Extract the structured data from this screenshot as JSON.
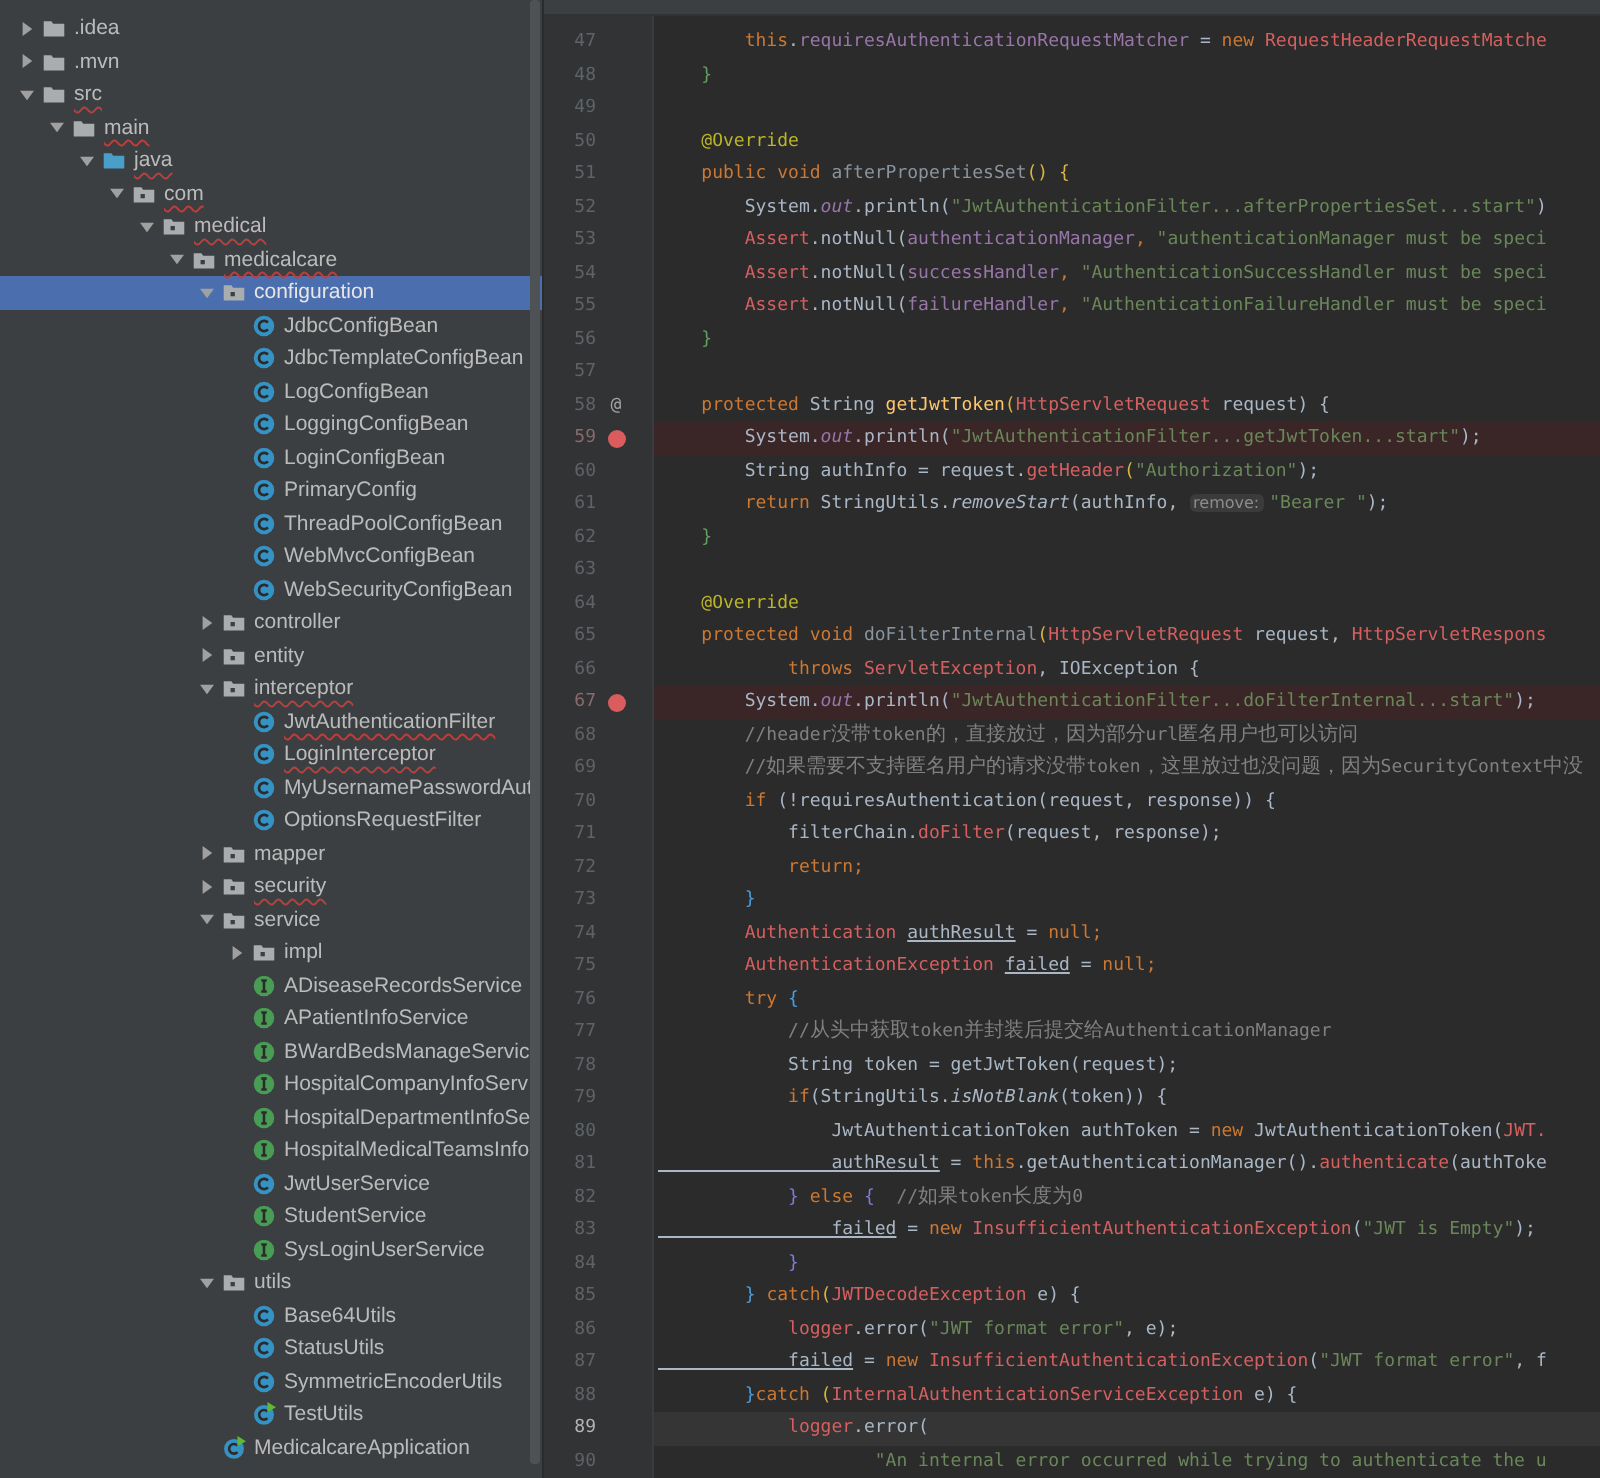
{
  "project_tree": {
    "nodes": [
      {
        "name": ".idea",
        "kind": "folder",
        "expanded": false,
        "selected": false,
        "spell_error": false
      },
      {
        "name": ".mvn",
        "kind": "folder",
        "expanded": false,
        "selected": false,
        "spell_error": false
      },
      {
        "name": "src",
        "kind": "folder",
        "expanded": true,
        "selected": false,
        "spell_error": true,
        "children": [
          {
            "name": "main",
            "kind": "folder",
            "expanded": true,
            "selected": false,
            "spell_error": true,
            "children": [
              {
                "name": "java",
                "kind": "source-folder",
                "expanded": true,
                "selected": false,
                "spell_error": true,
                "children": [
                  {
                    "name": "com",
                    "kind": "package",
                    "expanded": true,
                    "selected": false,
                    "spell_error": true,
                    "children": [
                      {
                        "name": "medical",
                        "kind": "package",
                        "expanded": true,
                        "selected": false,
                        "spell_error": true,
                        "children": [
                          {
                            "name": "medicalcare",
                            "kind": "package",
                            "expanded": true,
                            "selected": false,
                            "spell_error": true,
                            "children": [
                              {
                                "name": "configuration",
                                "kind": "package",
                                "expanded": true,
                                "selected": true,
                                "spell_error": false,
                                "children": [
                                  {
                                    "name": "JdbcConfigBean",
                                    "kind": "class",
                                    "selected": false,
                                    "spell_error": false
                                  },
                                  {
                                    "name": "JdbcTemplateConfigBean",
                                    "kind": "class",
                                    "selected": false,
                                    "spell_error": false
                                  },
                                  {
                                    "name": "LogConfigBean",
                                    "kind": "class",
                                    "selected": false,
                                    "spell_error": false
                                  },
                                  {
                                    "name": "LoggingConfigBean",
                                    "kind": "class",
                                    "selected": false,
                                    "spell_error": false
                                  },
                                  {
                                    "name": "LoginConfigBean",
                                    "kind": "class",
                                    "selected": false,
                                    "spell_error": false
                                  },
                                  {
                                    "name": "PrimaryConfig",
                                    "kind": "class",
                                    "selected": false,
                                    "spell_error": false
                                  },
                                  {
                                    "name": "ThreadPoolConfigBean",
                                    "kind": "class",
                                    "selected": false,
                                    "spell_error": false
                                  },
                                  {
                                    "name": "WebMvcConfigBean",
                                    "kind": "class",
                                    "selected": false,
                                    "spell_error": false
                                  },
                                  {
                                    "name": "WebSecurityConfigBean",
                                    "kind": "class",
                                    "selected": false,
                                    "spell_error": false
                                  }
                                ]
                              },
                              {
                                "name": "controller",
                                "kind": "package",
                                "expanded": false,
                                "selected": false,
                                "spell_error": false
                              },
                              {
                                "name": "entity",
                                "kind": "package",
                                "expanded": false,
                                "selected": false,
                                "spell_error": false
                              },
                              {
                                "name": "interceptor",
                                "kind": "package",
                                "expanded": true,
                                "selected": false,
                                "spell_error": true,
                                "children": [
                                  {
                                    "name": "JwtAuthenticationFilter",
                                    "kind": "class",
                                    "selected": false,
                                    "spell_error": true
                                  },
                                  {
                                    "name": "LoginInterceptor",
                                    "kind": "class",
                                    "selected": false,
                                    "spell_error": true
                                  },
                                  {
                                    "name": "MyUsernamePasswordAut",
                                    "kind": "class",
                                    "selected": false,
                                    "spell_error": false
                                  },
                                  {
                                    "name": "OptionsRequestFilter",
                                    "kind": "class",
                                    "selected": false,
                                    "spell_error": false
                                  }
                                ]
                              },
                              {
                                "name": "mapper",
                                "kind": "package",
                                "expanded": false,
                                "selected": false,
                                "spell_error": false
                              },
                              {
                                "name": "security",
                                "kind": "package",
                                "expanded": false,
                                "selected": false,
                                "spell_error": true
                              },
                              {
                                "name": "service",
                                "kind": "package",
                                "expanded": true,
                                "selected": false,
                                "spell_error": false,
                                "children": [
                                  {
                                    "name": "impl",
                                    "kind": "package",
                                    "expanded": false,
                                    "selected": false,
                                    "spell_error": false
                                  },
                                  {
                                    "name": "ADiseaseRecordsService",
                                    "kind": "interface",
                                    "selected": false,
                                    "spell_error": false
                                  },
                                  {
                                    "name": "APatientInfoService",
                                    "kind": "interface",
                                    "selected": false,
                                    "spell_error": false
                                  },
                                  {
                                    "name": "BWardBedsManageServic",
                                    "kind": "interface",
                                    "selected": false,
                                    "spell_error": false
                                  },
                                  {
                                    "name": "HospitalCompanyInfoServ",
                                    "kind": "interface",
                                    "selected": false,
                                    "spell_error": false
                                  },
                                  {
                                    "name": "HospitalDepartmentInfoSe",
                                    "kind": "interface",
                                    "selected": false,
                                    "spell_error": false
                                  },
                                  {
                                    "name": "HospitalMedicalTeamsInfo",
                                    "kind": "interface",
                                    "selected": false,
                                    "spell_error": false
                                  },
                                  {
                                    "name": "JwtUserService",
                                    "kind": "class",
                                    "selected": false,
                                    "spell_error": false
                                  },
                                  {
                                    "name": "StudentService",
                                    "kind": "interface",
                                    "selected": false,
                                    "spell_error": false
                                  },
                                  {
                                    "name": "SysLoginUserService",
                                    "kind": "interface",
                                    "selected": false,
                                    "spell_error": false
                                  }
                                ]
                              },
                              {
                                "name": "utils",
                                "kind": "package",
                                "expanded": true,
                                "selected": false,
                                "spell_error": false,
                                "children": [
                                  {
                                    "name": "Base64Utils",
                                    "kind": "class",
                                    "selected": false,
                                    "spell_error": false
                                  },
                                  {
                                    "name": "StatusUtils",
                                    "kind": "class",
                                    "selected": false,
                                    "spell_error": false
                                  },
                                  {
                                    "name": "SymmetricEncoderUtils",
                                    "kind": "class",
                                    "selected": false,
                                    "spell_error": false
                                  },
                                  {
                                    "name": "TestUtils",
                                    "kind": "runnable-class",
                                    "selected": false,
                                    "spell_error": false
                                  }
                                ]
                              },
                              {
                                "name": "MedicalcareApplication",
                                "kind": "runnable-class",
                                "selected": false,
                                "spell_error": false
                              }
                            ]
                          }
                        ]
                      }
                    ]
                  }
                ]
              }
            ]
          }
        ]
      }
    ]
  },
  "editor": {
    "lines": [
      {
        "number": "47",
        "breakpoint": false,
        "current": false,
        "tokens": [
          {
            "text": "        this",
            "kind": "kw"
          },
          {
            "text": ".",
            "kind": "plain"
          },
          {
            "text": "requiresAuthenticationRequestMatcher",
            "kind": "fld"
          },
          {
            "text": " = ",
            "kind": "plain"
          },
          {
            "text": "new ",
            "kind": "kw"
          },
          {
            "text": "RequestHeaderRequestMatche",
            "kind": "err"
          }
        ]
      },
      {
        "number": "48",
        "breakpoint": false,
        "current": false,
        "tokens": [
          {
            "text": "    }",
            "kind": "green"
          }
        ]
      },
      {
        "number": "49",
        "breakpoint": false,
        "current": false
      },
      {
        "number": "50",
        "breakpoint": false,
        "current": false,
        "tokens": [
          {
            "text": "    @Override",
            "kind": "ann"
          }
        ]
      },
      {
        "number": "51",
        "breakpoint": false,
        "current": false,
        "tokens": [
          {
            "text": "    public void ",
            "kind": "kw"
          },
          {
            "text": "afterPropertiesSet",
            "kind": "dim"
          },
          {
            "text": "() {",
            "kind": "yellow"
          }
        ]
      },
      {
        "number": "52",
        "breakpoint": false,
        "current": false,
        "tokens": [
          {
            "text": "        System.",
            "kind": "plain"
          },
          {
            "text": "out",
            "kind": "ifld"
          },
          {
            "text": ".println(",
            "kind": "plain"
          },
          {
            "text": "\"JwtAuthenticationFilter...afterPropertiesSet...start\"",
            "kind": "str"
          },
          {
            "text": ")",
            "kind": "plain"
          }
        ]
      },
      {
        "number": "53",
        "breakpoint": false,
        "current": false,
        "tokens": [
          {
            "text": "        Assert",
            "kind": "err"
          },
          {
            "text": ".notNull(",
            "kind": "plain"
          },
          {
            "text": "authenticationManager",
            "kind": "fld"
          },
          {
            "text": ", ",
            "kind": "kw"
          },
          {
            "text": "\"authenticationManager must be speci",
            "kind": "str"
          }
        ]
      },
      {
        "number": "54",
        "breakpoint": false,
        "current": false,
        "tokens": [
          {
            "text": "        Assert",
            "kind": "err"
          },
          {
            "text": ".notNull(",
            "kind": "plain"
          },
          {
            "text": "successHandler",
            "kind": "fld"
          },
          {
            "text": ", ",
            "kind": "kw"
          },
          {
            "text": "\"AuthenticationSuccessHandler must be speci",
            "kind": "str"
          }
        ]
      },
      {
        "number": "55",
        "breakpoint": false,
        "current": false,
        "tokens": [
          {
            "text": "        Assert",
            "kind": "err"
          },
          {
            "text": ".notNull(",
            "kind": "plain"
          },
          {
            "text": "failureHandler",
            "kind": "fld"
          },
          {
            "text": ", ",
            "kind": "kw"
          },
          {
            "text": "\"AuthenticationFailureHandler must be speci",
            "kind": "str"
          }
        ]
      },
      {
        "number": "56",
        "breakpoint": false,
        "current": false,
        "tokens": [
          {
            "text": "    }",
            "kind": "green"
          }
        ]
      },
      {
        "number": "57",
        "breakpoint": false,
        "current": false
      },
      {
        "number": "58",
        "breakpoint": false,
        "current": false,
        "gutter_mark": "@",
        "tokens": [
          {
            "text": "    protected ",
            "kind": "kw"
          },
          {
            "text": "String ",
            "kind": "plain"
          },
          {
            "text": "getJwtToken",
            "kind": "decl"
          },
          {
            "text": "(",
            "kind": "yellow"
          },
          {
            "text": "HttpServletRequest",
            "kind": "err"
          },
          {
            "text": " request) {",
            "kind": "plain"
          }
        ]
      },
      {
        "number": "59",
        "breakpoint": true,
        "current": false,
        "tokens": [
          {
            "text": "        System.",
            "kind": "plain"
          },
          {
            "text": "out",
            "kind": "ifld"
          },
          {
            "text": ".println(",
            "kind": "plain"
          },
          {
            "text": "\"JwtAuthenticationFilter...getJwtToken...start\"",
            "kind": "str"
          },
          {
            "text": ");",
            "kind": "plain"
          }
        ]
      },
      {
        "number": "60",
        "breakpoint": false,
        "current": false,
        "tokens": [
          {
            "text": "        String authInfo = request.",
            "kind": "plain"
          },
          {
            "text": "getHeader",
            "kind": "err"
          },
          {
            "text": "(",
            "kind": "yellow"
          },
          {
            "text": "\"Authorization\"",
            "kind": "str"
          },
          {
            "text": ");",
            "kind": "plain"
          }
        ]
      },
      {
        "number": "61",
        "breakpoint": false,
        "current": false,
        "tokens": [
          {
            "text": "        return ",
            "kind": "kw"
          },
          {
            "text": "StringUtils.",
            "kind": "plain"
          },
          {
            "text": "removeStart",
            "kind": "ital"
          },
          {
            "text": "(authInfo, ",
            "kind": "plain"
          },
          {
            "text": "remove:",
            "kind": "hint"
          },
          {
            "text": "\"Bearer \"",
            "kind": "str"
          },
          {
            "text": ");",
            "kind": "plain"
          }
        ]
      },
      {
        "number": "62",
        "breakpoint": false,
        "current": false,
        "tokens": [
          {
            "text": "    }",
            "kind": "green"
          }
        ]
      },
      {
        "number": "63",
        "breakpoint": false,
        "current": false
      },
      {
        "number": "64",
        "breakpoint": false,
        "current": false,
        "tokens": [
          {
            "text": "    @Override",
            "kind": "ann"
          }
        ]
      },
      {
        "number": "65",
        "breakpoint": false,
        "current": false,
        "tokens": [
          {
            "text": "    protected void ",
            "kind": "kw"
          },
          {
            "text": "doFilterInternal",
            "kind": "dim"
          },
          {
            "text": "(",
            "kind": "yellow"
          },
          {
            "text": "HttpServletRequest",
            "kind": "err"
          },
          {
            "text": " request, ",
            "kind": "plain"
          },
          {
            "text": "HttpServletRespons",
            "kind": "err"
          }
        ]
      },
      {
        "number": "66",
        "breakpoint": false,
        "current": false,
        "tokens": [
          {
            "text": "            throws ",
            "kind": "kw"
          },
          {
            "text": "ServletException",
            "kind": "err"
          },
          {
            "text": ", IOException {",
            "kind": "plain"
          }
        ]
      },
      {
        "number": "67",
        "breakpoint": true,
        "current": false,
        "tokens": [
          {
            "text": "        System.",
            "kind": "plain"
          },
          {
            "text": "out",
            "kind": "ifld"
          },
          {
            "text": ".println(",
            "kind": "plain"
          },
          {
            "text": "\"JwtAuthenticationFilter...doFilterInternal...start\"",
            "kind": "str"
          },
          {
            "text": ");",
            "kind": "plain"
          }
        ]
      },
      {
        "number": "68",
        "breakpoint": false,
        "current": false,
        "tokens": [
          {
            "text": "        //header没带token的，直接放过，因为部分url匿名用户也可以访问",
            "kind": "cmt"
          }
        ]
      },
      {
        "number": "69",
        "breakpoint": false,
        "current": false,
        "tokens": [
          {
            "text": "        //如果需要不支持匿名用户的请求没带token，这里放过也没问题，因为SecurityContext中没",
            "kind": "cmt"
          }
        ]
      },
      {
        "number": "70",
        "breakpoint": false,
        "current": false,
        "tokens": [
          {
            "text": "        if ",
            "kind": "kw"
          },
          {
            "text": "(!requiresAuthentication(request, response)) {",
            "kind": "plain"
          }
        ]
      },
      {
        "number": "71",
        "breakpoint": false,
        "current": false,
        "tokens": [
          {
            "text": "            filterChain.",
            "kind": "plain"
          },
          {
            "text": "doFilter",
            "kind": "err"
          },
          {
            "text": "(request, response);",
            "kind": "plain"
          }
        ]
      },
      {
        "number": "72",
        "breakpoint": false,
        "current": false,
        "tokens": [
          {
            "text": "            return;",
            "kind": "kw"
          }
        ]
      },
      {
        "number": "73",
        "breakpoint": false,
        "current": false,
        "tokens": [
          {
            "text": "        }",
            "kind": "blue"
          }
        ]
      },
      {
        "number": "74",
        "breakpoint": false,
        "current": false,
        "tokens": [
          {
            "text": "        Authentication ",
            "kind": "err"
          },
          {
            "text": "authResult",
            "kind": "ul"
          },
          {
            "text": " = ",
            "kind": "plain"
          },
          {
            "text": "null;",
            "kind": "kw"
          }
        ]
      },
      {
        "number": "75",
        "breakpoint": false,
        "current": false,
        "tokens": [
          {
            "text": "        AuthenticationException ",
            "kind": "err"
          },
          {
            "text": "failed",
            "kind": "ul"
          },
          {
            "text": " = ",
            "kind": "plain"
          },
          {
            "text": "null;",
            "kind": "kw"
          }
        ]
      },
      {
        "number": "76",
        "breakpoint": false,
        "current": false,
        "tokens": [
          {
            "text": "        try ",
            "kind": "kw"
          },
          {
            "text": "{",
            "kind": "blue"
          }
        ]
      },
      {
        "number": "77",
        "breakpoint": false,
        "current": false,
        "tokens": [
          {
            "text": "            //从头中获取token并封装后提交给AuthenticationManager",
            "kind": "cmt"
          }
        ]
      },
      {
        "number": "78",
        "breakpoint": false,
        "current": false,
        "tokens": [
          {
            "text": "            String token = getJwtToken(request);",
            "kind": "plain"
          }
        ]
      },
      {
        "number": "79",
        "breakpoint": false,
        "current": false,
        "tokens": [
          {
            "text": "            if",
            "kind": "kw"
          },
          {
            "text": "(StringUtils.",
            "kind": "plain"
          },
          {
            "text": "isNotBlank",
            "kind": "ital"
          },
          {
            "text": "(token)) {",
            "kind": "plain"
          }
        ]
      },
      {
        "number": "80",
        "breakpoint": false,
        "current": false,
        "tokens": [
          {
            "text": "                JwtAuthenticationToken authToken = ",
            "kind": "plain"
          },
          {
            "text": "new ",
            "kind": "kw"
          },
          {
            "text": "JwtAuthenticationToken(",
            "kind": "plain"
          },
          {
            "text": "JWT.",
            "kind": "err"
          }
        ]
      },
      {
        "number": "81",
        "breakpoint": false,
        "current": false,
        "tokens": [
          {
            "text": "                authResult",
            "kind": "ul"
          },
          {
            "text": " = ",
            "kind": "plain"
          },
          {
            "text": "this",
            "kind": "kw"
          },
          {
            "text": ".getAuthenticationManager().",
            "kind": "plain"
          },
          {
            "text": "authenticate",
            "kind": "err"
          },
          {
            "text": "(authToke",
            "kind": "plain"
          }
        ]
      },
      {
        "number": "82",
        "breakpoint": false,
        "current": false,
        "tokens": [
          {
            "text": "            } ",
            "kind": "purple"
          },
          {
            "text": "else ",
            "kind": "kw"
          },
          {
            "text": "{  ",
            "kind": "purple"
          },
          {
            "text": "//如果token长度为0",
            "kind": "cmt"
          }
        ]
      },
      {
        "number": "83",
        "breakpoint": false,
        "current": false,
        "tokens": [
          {
            "text": "                failed",
            "kind": "ul"
          },
          {
            "text": " = ",
            "kind": "plain"
          },
          {
            "text": "new ",
            "kind": "kw"
          },
          {
            "text": "InsufficientAuthenticationException",
            "kind": "err"
          },
          {
            "text": "(",
            "kind": "plain"
          },
          {
            "text": "\"JWT is Empty\"",
            "kind": "str"
          },
          {
            "text": ");",
            "kind": "plain"
          }
        ]
      },
      {
        "number": "84",
        "breakpoint": false,
        "current": false,
        "tokens": [
          {
            "text": "            }",
            "kind": "purple"
          }
        ]
      },
      {
        "number": "85",
        "breakpoint": false,
        "current": false,
        "tokens": [
          {
            "text": "        } ",
            "kind": "blue"
          },
          {
            "text": "catch",
            "kind": "kw"
          },
          {
            "text": "(",
            "kind": "yellow"
          },
          {
            "text": "JWTDecodeException",
            "kind": "err"
          },
          {
            "text": " e) {",
            "kind": "plain"
          }
        ]
      },
      {
        "number": "86",
        "breakpoint": false,
        "current": false,
        "tokens": [
          {
            "text": "            logger",
            "kind": "err"
          },
          {
            "text": ".error(",
            "kind": "plain"
          },
          {
            "text": "\"JWT format error\"",
            "kind": "str"
          },
          {
            "text": ", e);",
            "kind": "plain"
          }
        ]
      },
      {
        "number": "87",
        "breakpoint": false,
        "current": false,
        "tokens": [
          {
            "text": "            failed",
            "kind": "ul"
          },
          {
            "text": " = ",
            "kind": "plain"
          },
          {
            "text": "new ",
            "kind": "kw"
          },
          {
            "text": "InsufficientAuthenticationException",
            "kind": "err"
          },
          {
            "text": "(",
            "kind": "plain"
          },
          {
            "text": "\"JWT format error\"",
            "kind": "str"
          },
          {
            "text": ", f",
            "kind": "plain"
          }
        ]
      },
      {
        "number": "88",
        "breakpoint": false,
        "current": false,
        "tokens": [
          {
            "text": "        }",
            "kind": "blue"
          },
          {
            "text": "catch ",
            "kind": "kw"
          },
          {
            "text": "(",
            "kind": "yellow"
          },
          {
            "text": "InternalAuthenticationServiceException",
            "kind": "err"
          },
          {
            "text": " e) {",
            "kind": "plain"
          }
        ]
      },
      {
        "number": "89",
        "breakpoint": false,
        "current": true,
        "tokens": [
          {
            "text": "            logger",
            "kind": "err"
          },
          {
            "text": ".error(",
            "kind": "plain"
          }
        ]
      },
      {
        "number": "90",
        "breakpoint": false,
        "current": false,
        "tokens": [
          {
            "text": "                    \"An internal error occurred while trying to authenticate the u",
            "kind": "str"
          }
        ]
      }
    ]
  }
}
